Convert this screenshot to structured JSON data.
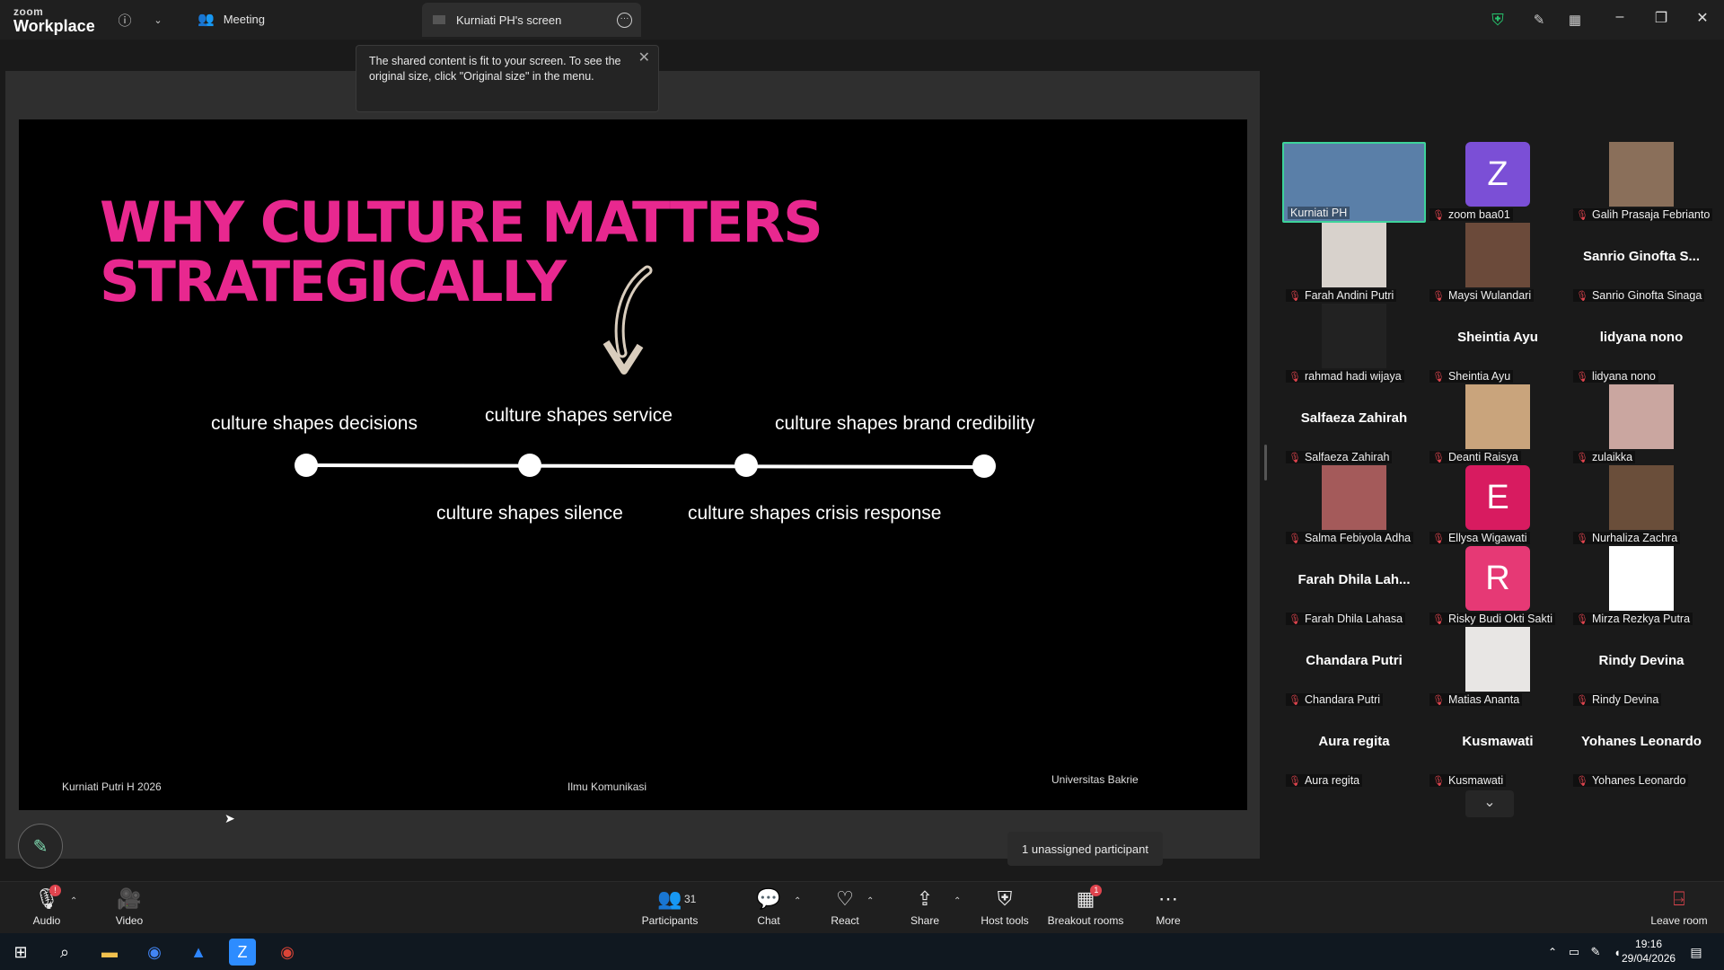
{
  "titlebar": {
    "logo_small": "zoom",
    "logo_big": "Workplace",
    "meeting_label": "Meeting",
    "screen_tab_label": "Kurniati PH's screen"
  },
  "toast": {
    "text": "The shared content is fit to your screen. To see the original size, click \"Original size\" in the menu."
  },
  "slide": {
    "title_line1": "WHY CULTURE MATTERS",
    "title_line2": "STRATEGICALLY",
    "title_color": "#e8288f",
    "timeline_top": [
      "culture shapes decisions",
      "culture shapes service",
      "culture shapes brand credibility"
    ],
    "timeline_bottom": [
      "culture shapes silence",
      "culture shapes crisis response"
    ],
    "footer_left": "Kurniati Putri H 2026",
    "footer_center": "Ilmu Komunikasi",
    "footer_right": "Universitas Bakrie"
  },
  "unassigned": "1 unassigned participant",
  "participants": [
    {
      "name": "Kurniati PH",
      "type": "video",
      "bg": "#5a7fa8",
      "active": true
    },
    {
      "name": "zoom baa01",
      "type": "avatar",
      "letter": "Z",
      "bg": "#7b4fd6"
    },
    {
      "name": "Galih Prasaja Febrianto",
      "type": "video",
      "bg": "#8a6f5a"
    },
    {
      "name": "Farah Andini Putri",
      "type": "video",
      "bg": "#d8d2cc"
    },
    {
      "name": "Maysi Wulandari",
      "type": "video",
      "bg": "#6b4a3a"
    },
    {
      "name": "Sanrio Ginofta Sinaga",
      "type": "text",
      "display": "Sanrio  Ginofta  S..."
    },
    {
      "name": "rahmad hadi wijaya",
      "type": "video",
      "bg": "#222222"
    },
    {
      "name": "Sheintia Ayu",
      "type": "text",
      "display": "Sheintia Ayu"
    },
    {
      "name": "lidyana nono",
      "type": "text",
      "display": "lidyana nono"
    },
    {
      "name": "Salfaeza Zahirah",
      "type": "text",
      "display": "Salfaeza Zahirah"
    },
    {
      "name": "Deanti Raisya",
      "type": "video",
      "bg": "#c9a47c"
    },
    {
      "name": "zulaikka",
      "type": "video",
      "bg": "#caa6a0"
    },
    {
      "name": "Salma Febiyola Adha",
      "type": "video",
      "bg": "#a45a5a"
    },
    {
      "name": "Ellysa Wigawati",
      "type": "avatar",
      "letter": "E",
      "bg": "#d81b60"
    },
    {
      "name": "Nurhaliza Zachra",
      "type": "video",
      "bg": "#6a4e3a"
    },
    {
      "name": "Farah Dhila Lahasa",
      "type": "text",
      "display": "Farah Dhila Lah..."
    },
    {
      "name": "Risky Budi Okti Sakti",
      "type": "avatar",
      "letter": "R",
      "bg": "#e63975"
    },
    {
      "name": "Mirza Rezkya Putra",
      "type": "video",
      "bg": "#ffffff"
    },
    {
      "name": "Chandara Putri",
      "type": "text",
      "display": "Chandara Putri"
    },
    {
      "name": "Matias Ananta",
      "type": "video",
      "bg": "#e8e6e4"
    },
    {
      "name": "Rindy Devina",
      "type": "text",
      "display": "Rindy Devina"
    },
    {
      "name": "Aura regita",
      "type": "text",
      "display": "Aura regita"
    },
    {
      "name": "Kusmawati",
      "type": "text",
      "display": "Kusmawati"
    },
    {
      "name": "Yohanes Leonardo",
      "type": "text",
      "display": "Yohanes Leonardo"
    }
  ],
  "toolbar": {
    "audio": "Audio",
    "video": "Video",
    "participants": "Participants",
    "participant_count": "31",
    "chat": "Chat",
    "react": "React",
    "share": "Share",
    "host_tools": "Host tools",
    "breakout": "Breakout rooms",
    "breakout_badge": "1",
    "more": "More",
    "leave": "Leave room"
  },
  "taskbar": {
    "time": "19:16",
    "date": "29/04/2026"
  }
}
